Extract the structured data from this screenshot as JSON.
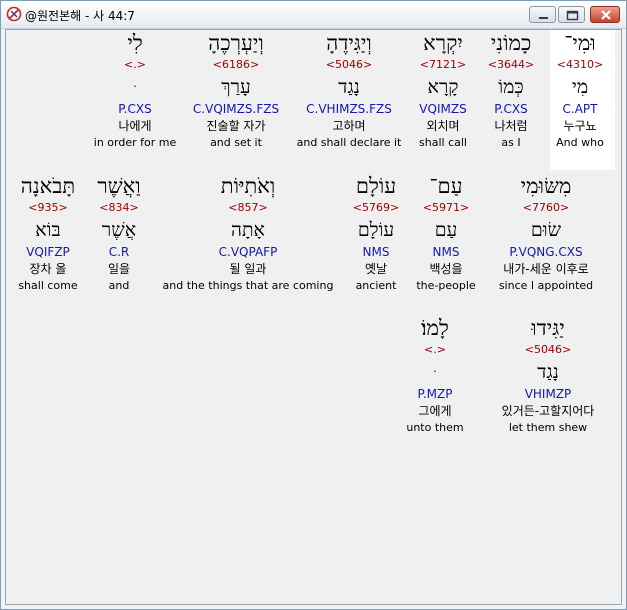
{
  "window": {
    "title": "@원전본해 - 사 44:7",
    "buttons": {
      "minimize": "minimize-icon",
      "maximize": "maximize-icon",
      "close": "close-icon"
    }
  },
  "words": [
    {
      "heb": "וּמִי־",
      "num": "<4310>",
      "root": "מִי",
      "parse": "C.APT",
      "kor": "누구뇨",
      "eng": "And who"
    },
    {
      "heb": "כָמוֹנִי",
      "num": "<3644>",
      "root": "כְּמוֹ",
      "parse": "P.CXS",
      "kor": "나처럼",
      "eng": "as I"
    },
    {
      "heb": "יִקְרָא",
      "num": "<7121>",
      "root": "קָרָא",
      "parse": "VQIMZS",
      "kor": "외치며",
      "eng": "shall call"
    },
    {
      "heb": "וְיַגִּידֶהָ",
      "num": "<5046>",
      "root": "נָגַד",
      "parse": "C.VHIMZS.FZS",
      "kor": "고하며",
      "eng": "and shall declare it"
    },
    {
      "heb": "וְיַעְרְכֶהָ",
      "num": "<6186>",
      "root": "עָרַךְ",
      "parse": "C.VQIMZS.FZS",
      "kor": "진술할 자가",
      "eng": "and set it"
    },
    {
      "heb": "לִי",
      "num": "<.>",
      "root": "ּ",
      "parse": "P.CXS",
      "kor": "나에게",
      "eng": "in order for me"
    },
    {
      "heb": "מִשּׂוּמִי",
      "num": "<7760>",
      "root": "שׂוּם",
      "parse": "P.VQNG.CXS",
      "kor": "내가-세운 이후로",
      "eng": "since I appointed"
    },
    {
      "heb": "עַם־",
      "num": "<5971>",
      "root": "עַם",
      "parse": "NMS",
      "kor": "백성을",
      "eng": "the-people"
    },
    {
      "heb": "עוֹלָם",
      "num": "<5769>",
      "root": "עוֹלָם",
      "parse": "NMS",
      "kor": "옛날",
      "eng": "ancient"
    },
    {
      "heb": "וְאֹתִיּוֹת",
      "num": "<857>",
      "root": "אָתָה",
      "parse": "C.VQPAFP",
      "kor": "될 일과",
      "eng": "and the things that are coming"
    },
    {
      "heb": "וַאֲשֶׁר",
      "num": "<834>",
      "root": "אֲשֶׁר",
      "parse": "C.R",
      "kor": "일을",
      "eng": "and"
    },
    {
      "heb": "תָּבֹאנָה",
      "num": "<935>",
      "root": "בּוֹא",
      "parse": "VQIFZP",
      "kor": "장차 올",
      "eng": "shall come"
    },
    {
      "heb": "יַגִּידוּ",
      "num": "<5046>",
      "root": "נָגַד",
      "parse": "VHIMZP",
      "kor": "있거든-고할지어다",
      "eng": "let them shew"
    },
    {
      "heb": "לָמוֹ׃",
      "num": "<.>",
      "root": "ּ",
      "parse": "P.MZP",
      "kor": "그에게",
      "eng": "unto them"
    }
  ]
}
